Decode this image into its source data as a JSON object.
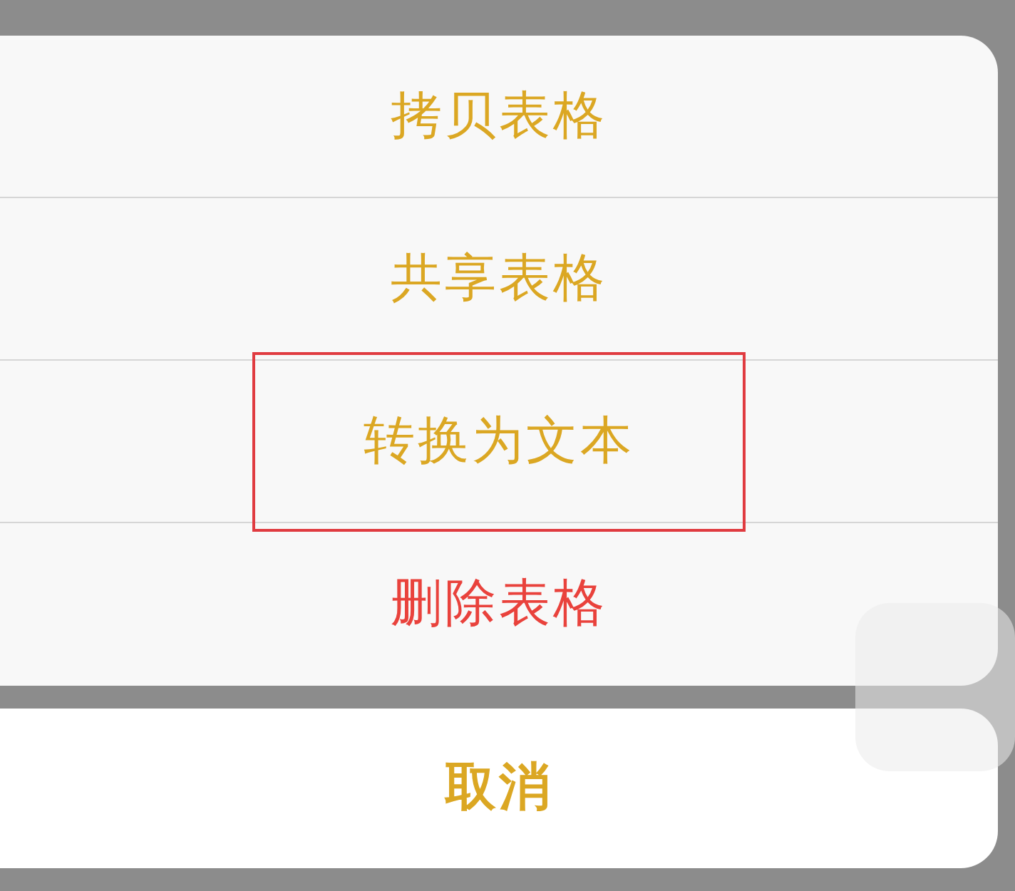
{
  "action_sheet": {
    "items": [
      {
        "label": "拷贝表格",
        "kind": "default",
        "highlighted": false
      },
      {
        "label": "共享表格",
        "kind": "default",
        "highlighted": false
      },
      {
        "label": "转换为文本",
        "kind": "default",
        "highlighted": true
      },
      {
        "label": "删除表格",
        "kind": "destructive",
        "highlighted": false
      }
    ]
  },
  "cancel_button": {
    "label": "取消"
  }
}
